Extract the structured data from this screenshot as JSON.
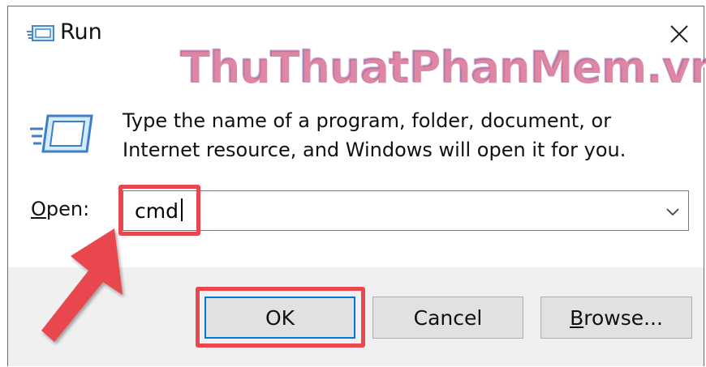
{
  "window": {
    "title": "Run",
    "close_icon": "close-icon"
  },
  "watermark": "ThuThuatPhanMem.vn",
  "content": {
    "description": "Type the name of a program, folder, document, or Internet resource, and Windows will open it for you.",
    "open_label_accel": "O",
    "open_label_rest": "pen:",
    "open_value": "cmd"
  },
  "buttons": {
    "ok": "OK",
    "cancel": "Cancel",
    "browse_accel": "B",
    "browse_rest": "rowse..."
  },
  "colors": {
    "highlight": "#e8474e",
    "accent": "#0078d7"
  }
}
